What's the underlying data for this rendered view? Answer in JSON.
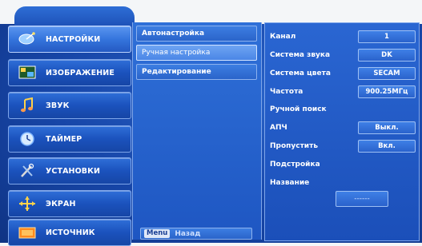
{
  "sidebar": {
    "items": [
      {
        "label": "НАСТРОЙКИ",
        "icon": "satellite-dish-icon"
      },
      {
        "label": "ИЗОБРАЖЕНИЕ",
        "icon": "picture-icon"
      },
      {
        "label": "ЗВУК",
        "icon": "music-note-icon"
      },
      {
        "label": "ТАЙМЕР",
        "icon": "clock-icon"
      },
      {
        "label": "УСТАНОВКИ",
        "icon": "tools-icon"
      },
      {
        "label": "ЭКРАН",
        "icon": "screen-icon"
      },
      {
        "label": "ИСТОЧНИК",
        "icon": "input-source-icon"
      }
    ]
  },
  "submenu": {
    "items": [
      {
        "label": "Автонастройка"
      },
      {
        "label": "Ручная настройка"
      },
      {
        "label": "Редактирование"
      }
    ],
    "footer": {
      "menu_key": "Menu",
      "back_label": "Назад"
    }
  },
  "settings": {
    "channel_label": "Канал",
    "channel_value": "1",
    "sound_system_label": "Система звука",
    "sound_system_value": "DK",
    "color_system_label": "Система цвета",
    "color_system_value": "SECAM",
    "frequency_label": "Частота",
    "frequency_value": "900.25МГц",
    "manual_search_label": "Ручной поиск",
    "afc_label": "АПЧ",
    "afc_value": "Выкл.",
    "skip_label": "Пропустить",
    "skip_value": "Вкл.",
    "fine_tune_label": "Подстройка",
    "name_label": "Название",
    "name_value": "------"
  },
  "colors": {
    "panel_blue": "#1b4fb9",
    "highlight_blue": "#4a86e6",
    "border_light": "#8db2ee"
  }
}
